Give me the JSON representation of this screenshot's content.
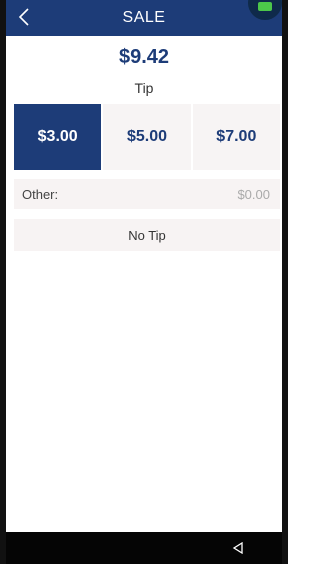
{
  "header": {
    "title": "SALE",
    "back_icon": "chevron-left-icon",
    "status_icon": "battery-icon",
    "bar_color": "#1d3c78",
    "battery_color": "#4cc74a"
  },
  "sale": {
    "amount": "$9.42",
    "tip_label": "Tip"
  },
  "tip_options": [
    {
      "label": "$3.00",
      "selected": true
    },
    {
      "label": "$5.00",
      "selected": false
    },
    {
      "label": "$7.00",
      "selected": false
    }
  ],
  "other": {
    "label": "Other:",
    "placeholder": "$0.00"
  },
  "no_tip": {
    "label": "No Tip"
  },
  "nav": {
    "back_icon": "triangle-back-icon"
  },
  "colors": {
    "accent": "#1d3c78",
    "option_bg": "#f7f4f4"
  }
}
